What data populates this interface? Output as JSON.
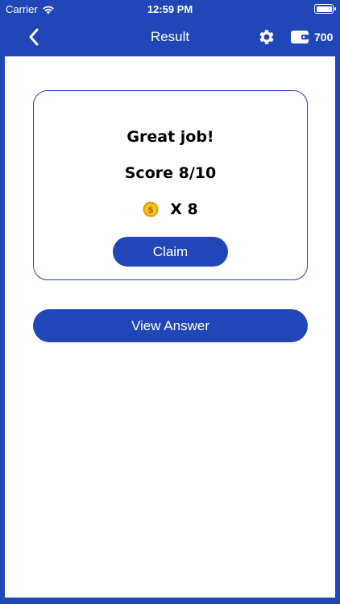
{
  "status_bar": {
    "carrier": "Carrier",
    "time": "12:59 PM"
  },
  "nav": {
    "title": "Result",
    "wallet_count": "700",
    "back_icon": "chevron-left-icon",
    "settings_icon": "gear-icon",
    "wallet_icon": "wallet-icon"
  },
  "result": {
    "message": "Great job!",
    "score": "Score 8/10",
    "reward_text": "X 8",
    "coin_icon": "coin-icon",
    "claim_label": "Claim"
  },
  "actions": {
    "view_answer_label": "View Answer"
  },
  "colors": {
    "primary": "#2046b8",
    "surface": "#ffffff",
    "coin": "#f5b800"
  }
}
